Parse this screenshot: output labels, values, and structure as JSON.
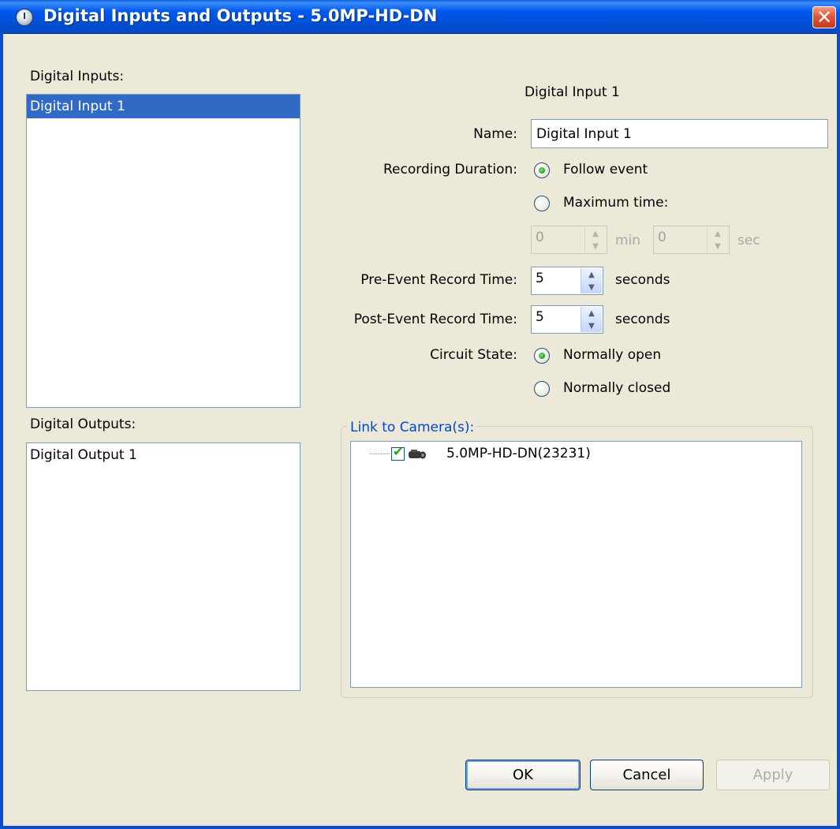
{
  "window": {
    "title": "Digital Inputs and Outputs - 5.0MP-HD-DN",
    "close_label": "✕"
  },
  "inputs_panel": {
    "label": "Digital Inputs:",
    "items": [
      {
        "label": "Digital Input 1",
        "selected": true
      }
    ]
  },
  "outputs_panel": {
    "label": "Digital Outputs:",
    "items": [
      {
        "label": "Digital Output 1",
        "selected": false
      }
    ]
  },
  "detail": {
    "heading": "Digital Input 1",
    "name_label": "Name:",
    "name_value": "Digital Input 1",
    "recording_duration_label": "Recording Duration:",
    "follow_event_label": "Follow event",
    "follow_event_selected": true,
    "maximum_time_label": "Maximum time:",
    "maximum_time_selected": false,
    "max_min_value": "0",
    "min_unit": "min",
    "max_sec_value": "0",
    "sec_unit": "sec",
    "pre_event_label": "Pre-Event Record Time:",
    "pre_event_value": "5",
    "post_event_label": "Post-Event Record Time:",
    "post_event_value": "5",
    "seconds_unit": "seconds",
    "circuit_state_label": "Circuit State:",
    "normally_open_label": "Normally open",
    "normally_open_selected": true,
    "normally_closed_label": "Normally closed",
    "normally_closed_selected": false
  },
  "link_group": {
    "legend": "Link to Camera(s):",
    "cameras": [
      {
        "label": "5.0MP-HD-DN(23231)",
        "checked": true,
        "icon": "camera-icon"
      }
    ]
  },
  "buttons": {
    "ok": "OK",
    "cancel": "Cancel",
    "apply": "Apply"
  },
  "colors": {
    "titlebar": "#0058ee",
    "selection": "#316ac5",
    "dialog_bg": "#ece9d8",
    "legend_text": "#0046d5",
    "radio_dot": "#21a121"
  }
}
